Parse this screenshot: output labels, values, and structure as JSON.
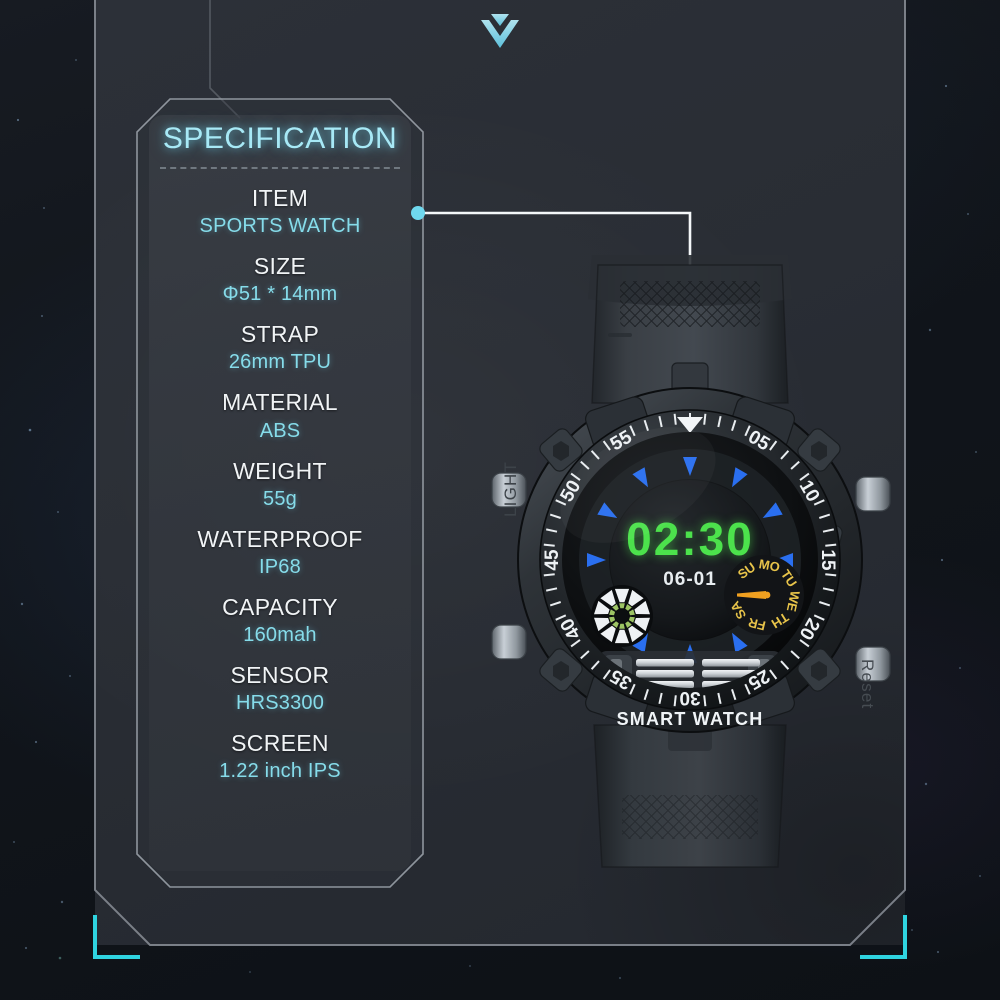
{
  "panel": {
    "title": "SPECIFICATION",
    "rows": [
      {
        "key": "ITEM",
        "value": "SPORTS WATCH"
      },
      {
        "key": "SIZE",
        "value": "Φ51 * 14mm"
      },
      {
        "key": "STRAP",
        "value": "26mm TPU"
      },
      {
        "key": "MATERIAL",
        "value": "ABS"
      },
      {
        "key": "WEIGHT",
        "value": "55g"
      },
      {
        "key": "WATERPROOF",
        "value": "IP68"
      },
      {
        "key": "CAPACITY",
        "value": "160mah"
      },
      {
        "key": "SENSOR",
        "value": "HRS3300"
      },
      {
        "key": "SCREEN",
        "value": "1.22 inch  IPS"
      }
    ]
  },
  "watch": {
    "display_time": "02:30",
    "display_date": "06-01",
    "brand_label": "SMART WATCH",
    "left_button_label": "LIGHT",
    "right_button_label": "Reset",
    "weekday_labels": [
      "SU",
      "MO",
      "TU",
      "WE",
      "TH",
      "FR",
      "SA"
    ],
    "bezel_numerals": [
      "05",
      "10",
      "15",
      "20",
      "25",
      "30",
      "35",
      "40",
      "45",
      "50",
      "55"
    ]
  },
  "colors": {
    "accent_cyan": "#86dcea",
    "title_cyan": "#a7e9f6",
    "display_green": "#4ce24c",
    "marker_blue": "#2a6ff0",
    "weekday_gold": "#e8c44a",
    "battery_orange": "#f07a1e",
    "frame_gray": "#8d939b"
  }
}
